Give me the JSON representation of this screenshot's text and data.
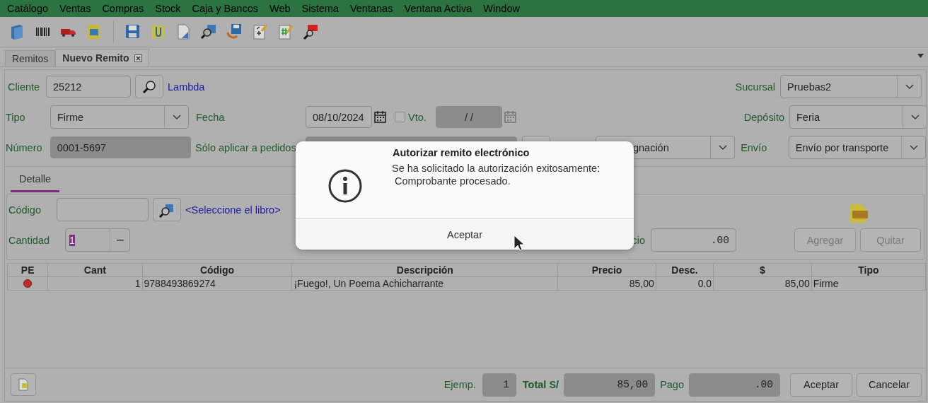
{
  "menu": [
    "Catálogo",
    "Ventas",
    "Compras",
    "Stock",
    "Caja y Bancos",
    "Web",
    "Sistema",
    "Ventanas",
    "Ventana Activa",
    "Window"
  ],
  "tabs": [
    {
      "label": "Remitos",
      "selected": false
    },
    {
      "label": "Nuevo Remito",
      "selected": true
    }
  ],
  "header": {
    "cliente": {
      "label": "Cliente",
      "value": "25212",
      "name": "Lambda"
    },
    "sucursal": {
      "label": "Sucursal",
      "value": "Pruebas2"
    },
    "tipo": {
      "label": "Tipo",
      "value": "Firme"
    },
    "fecha": {
      "label": "Fecha",
      "value": "08/10/2024"
    },
    "vto": {
      "label": "Vto.",
      "checked": false,
      "value": "/ /"
    },
    "deposito": {
      "label": "Depósito",
      "value": "Feria"
    },
    "numero": {
      "label": "Número",
      "value": "0001-5697"
    },
    "pedidos": {
      "label": "Sólo aplicar a pedidos"
    },
    "combo_3": {
      "value": "gnación"
    },
    "envio": {
      "label": "Envío",
      "value": "Envío por transporte"
    }
  },
  "detail_tabs": [
    {
      "label": "Detalle",
      "selected": true
    }
  ],
  "detail": {
    "codigo": {
      "label": "Código"
    },
    "libro": "<Seleccione el libro>",
    "cantidad": {
      "label": "Cantidad",
      "value": "1"
    },
    "precio": {
      "label": "cio",
      "value": ".00"
    },
    "buttons": [
      {
        "label": "Agregar",
        "disabled": true
      },
      {
        "label": "Quitar",
        "disabled": true
      }
    ]
  },
  "table": {
    "columns": [
      "PE",
      "Cant",
      "Código",
      "Descripción",
      "Precio",
      "Desc.",
      "$",
      "Tipo"
    ],
    "rows": [
      {
        "color": "#c42a2a",
        "cells": [
          "",
          "1",
          "9788493869274",
          "¡Fuego!, Un Poema Achicharrante",
          "85,00",
          "0.0",
          "85,00",
          "Firme"
        ]
      }
    ]
  },
  "footer": {
    "ejemplares": {
      "label": "Ejemp.",
      "value": "1"
    },
    "total": {
      "label": "Total S/",
      "value": "85,00"
    },
    "pago": {
      "label": "Pago",
      "value": ".00"
    },
    "buttons": [
      "Aceptar",
      "Cancelar"
    ]
  },
  "dialog": {
    "title": "Autorizar remito electrónico",
    "message": "Se ha solicitado la autorización exitosamente:\n Comprobante procesado.",
    "button": "Aceptar"
  }
}
